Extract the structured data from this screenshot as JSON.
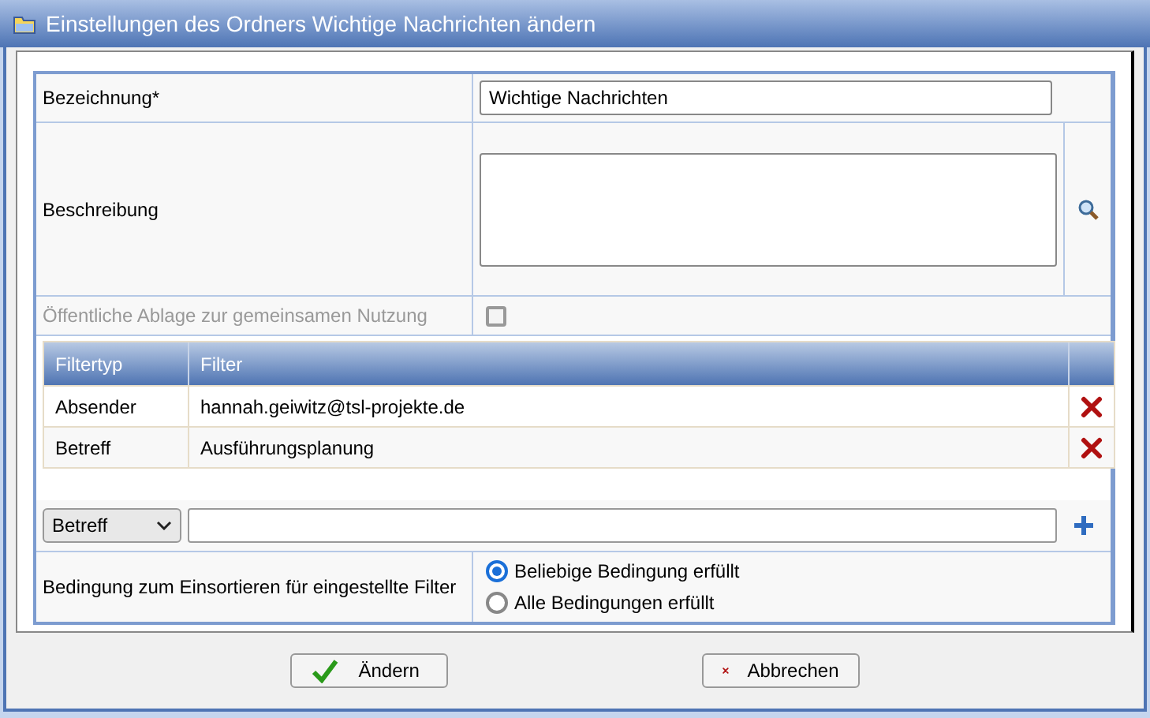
{
  "window": {
    "title": "Einstellungen des Ordners Wichtige Nachrichten ändern"
  },
  "name": {
    "label": "Bezeichnung*",
    "value": "Wichtige Nachrichten"
  },
  "description": {
    "label": "Beschreibung"
  },
  "public": {
    "label": "Öffentliche Ablage zur gemeinsamen Nutzung",
    "checked": false,
    "disabled": true
  },
  "filter_table": {
    "columns": [
      "Filtertyp",
      "Filter"
    ],
    "rows": [
      {
        "type": "Absender",
        "filter": "hannah.geiwitz@tsl-projekte.de"
      },
      {
        "type": "Betreff",
        "filter": "Ausführungsplanung"
      }
    ]
  },
  "new_filter": {
    "type": "Betreff"
  },
  "condition": {
    "label": "Bedingung zum Einsortieren für eingestellte Filter",
    "options": [
      {
        "label": "Beliebige Bedingung erfüllt",
        "selected": true
      },
      {
        "label": "Alle Bedingungen erfüllt",
        "selected": false
      }
    ]
  },
  "buttons": [
    {
      "label": "Ändern",
      "kind": "ok"
    },
    {
      "label": "Abbrechen",
      "kind": "cancel"
    }
  ]
}
